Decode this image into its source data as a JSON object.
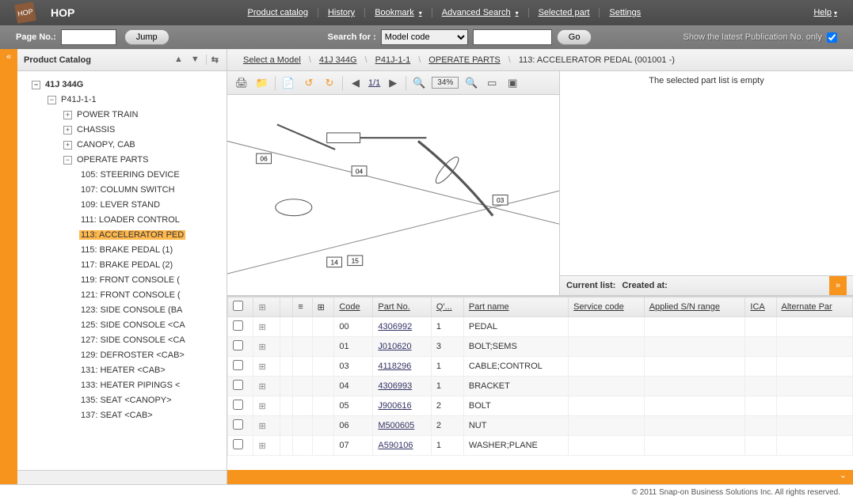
{
  "brand": "HOP",
  "topmenu": [
    "Product catalog",
    "History",
    "Bookmark",
    "Advanced Search",
    "Selected part",
    "Settings"
  ],
  "topmenu_dropdown": [
    false,
    false,
    true,
    true,
    false,
    false
  ],
  "help": "Help",
  "page_no_label": "Page No.:",
  "jump_label": "Jump",
  "search_for_label": "Search for :",
  "search_mode": "Model code",
  "go_label": "Go",
  "pub_text": "Show the latest Publication No. only",
  "sidebar_title": "Product Catalog",
  "tree": {
    "root": "41J 344G",
    "l1": "P41J-1-1",
    "l2": [
      "POWER TRAIN",
      "CHASSIS",
      "CANOPY, CAB",
      "OPERATE PARTS"
    ],
    "l2_expanded": [
      false,
      false,
      false,
      true
    ],
    "operate_parts": [
      "105: STEERING DEVICE",
      "107: COLUMN SWITCH",
      "109: LEVER STAND",
      "111: LOADER CONTROL",
      "113: ACCELERATOR PED",
      "115: BRAKE PEDAL (1)",
      "117: BRAKE PEDAL (2)",
      "119: FRONT CONSOLE (",
      "121: FRONT CONSOLE (",
      "123: SIDE CONSOLE (BA",
      "125: SIDE CONSOLE <CA",
      "127: SIDE CONSOLE <CA",
      "129: DEFROSTER <CAB>",
      "131: HEATER <CAB>",
      "133: HEATER PIPINGS <",
      "135: SEAT <CANOPY>",
      "137: SEAT <CAB>"
    ],
    "selected_index": 4
  },
  "breadcrumb": {
    "select_model": "Select a Model",
    "model": "41J 344G",
    "pub": "P41J-1-1",
    "group": "OPERATE PARTS",
    "leaf": "113: ACCELERATOR PEDAL (001001 -)"
  },
  "diag_page": "1/1",
  "zoom": "34%",
  "callouts": [
    "06",
    "04",
    "03",
    "14",
    "15"
  ],
  "empty_msg": "The selected part list is empty",
  "current_list_label": "Current list:",
  "created_at_label": "Created at:",
  "table_headers": [
    "Code",
    "Part No.",
    "Q'...",
    "Part name",
    "Service code",
    "Applied S/N range",
    "ICA",
    "Alternate Par"
  ],
  "parts": [
    {
      "code": "00",
      "partno": "4306992",
      "qty": "1",
      "name": "PEDAL"
    },
    {
      "code": "01",
      "partno": "J010620",
      "qty": "3",
      "name": "BOLT;SEMS"
    },
    {
      "code": "03",
      "partno": "4118296",
      "qty": "1",
      "name": "CABLE;CONTROL"
    },
    {
      "code": "04",
      "partno": "4306993",
      "qty": "1",
      "name": "BRACKET"
    },
    {
      "code": "05",
      "partno": "J900616",
      "qty": "2",
      "name": "BOLT"
    },
    {
      "code": "06",
      "partno": "M500605",
      "qty": "2",
      "name": "NUT"
    },
    {
      "code": "07",
      "partno": "A590106",
      "qty": "1",
      "name": "WASHER;PLANE"
    }
  ],
  "footer": "© 2011 Snap-on Business Solutions Inc. All rights reserved."
}
